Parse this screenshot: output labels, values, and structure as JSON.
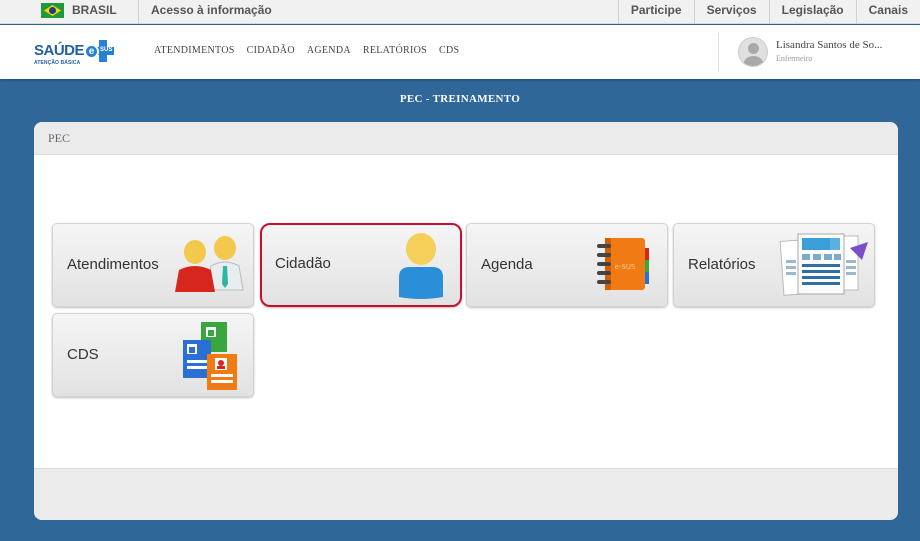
{
  "gov_bar": {
    "country": "BRASIL",
    "access_link": "Acesso à informação",
    "links": [
      "Participe",
      "Serviços",
      "Legislação",
      "Canais"
    ]
  },
  "header": {
    "logo_text": "SAÚDE",
    "logo_badge": "e",
    "logo_badge_sub": "SUS",
    "logo_subtitle": "ATENÇÃO BÁSICA",
    "nav": [
      "ATENDIMENTOS",
      "CIDADÃO",
      "AGENDA",
      "RELATÓRIOS",
      "CDS"
    ],
    "user_name": "Lisandra Santos de So...",
    "user_role": "Enfermeiro"
  },
  "page_title": "PEC - TREINAMENTO",
  "panel": {
    "title": "PEC",
    "tiles": [
      {
        "label": "Atendimentos",
        "icon": "people-icon"
      },
      {
        "label": "Cidadão",
        "icon": "person-icon",
        "selected": true
      },
      {
        "label": "Agenda",
        "icon": "notebook-icon",
        "notebook_text": "e-SUS"
      },
      {
        "label": "Relatórios",
        "icon": "reports-icon"
      },
      {
        "label": "CDS",
        "icon": "forms-icon"
      }
    ]
  },
  "colors": {
    "background": "#2f6799",
    "selected_outline": "#c8102e",
    "brand_blue": "#1f5fa8"
  }
}
